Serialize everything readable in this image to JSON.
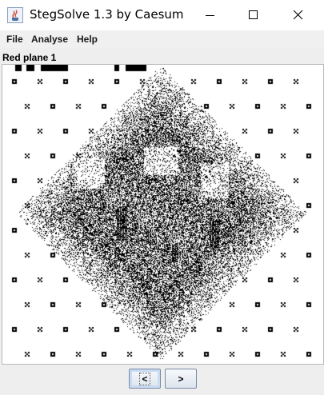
{
  "window": {
    "title": "StegSolve 1.3 by Caesum",
    "icon": "java-cup-icon",
    "controls": [
      "minimize-icon",
      "maximize-icon",
      "close-icon"
    ]
  },
  "menu": {
    "items": [
      "File",
      "Analyse",
      "Help"
    ]
  },
  "viewer": {
    "plane_label": "Red plane 1",
    "colors": {
      "ink": "#000000",
      "paper": "#ffffff"
    }
  },
  "navigation": {
    "prev_label": "<",
    "next_label": ">"
  }
}
